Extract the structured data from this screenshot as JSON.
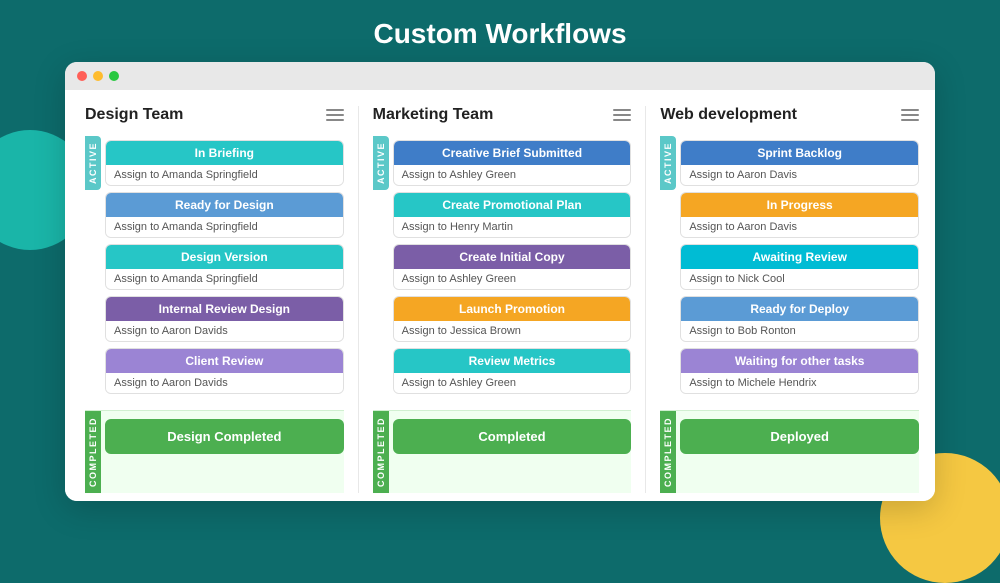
{
  "page": {
    "title": "Custom Workflows",
    "background_color": "#0d6b6b"
  },
  "columns": [
    {
      "id": "design-team",
      "title": "Design Team",
      "active_label": "ACTIVE",
      "completed_label": "COMPLETED",
      "tasks": [
        {
          "label": "In Briefing",
          "color_class": "color-teal",
          "assignee": "Assign to Amanda Springfield"
        },
        {
          "label": "Ready for Design",
          "color_class": "color-blue-light",
          "assignee": "Assign to Amanda Springfield"
        },
        {
          "label": "Design Version",
          "color_class": "color-teal",
          "assignee": "Assign to Amanda Springfield"
        },
        {
          "label": "Internal Review Design",
          "color_class": "color-purple",
          "assignee": "Assign to Aaron Davids"
        },
        {
          "label": "Client Review",
          "color_class": "color-lavender",
          "assignee": "Assign to Aaron Davids"
        }
      ],
      "completed_task": "Design Completed"
    },
    {
      "id": "marketing-team",
      "title": "Marketing Team",
      "active_label": "ACTIVE",
      "completed_label": "COMPLETED",
      "tasks": [
        {
          "label": "Creative Brief Submitted",
          "color_class": "color-blue",
          "assignee": "Assign to Ashley Green"
        },
        {
          "label": "Create Promotional Plan",
          "color_class": "color-teal",
          "assignee": "Assign to Henry Martin"
        },
        {
          "label": "Create Initial Copy",
          "color_class": "color-purple",
          "assignee": "Assign to Ashley Green"
        },
        {
          "label": "Launch Promotion",
          "color_class": "color-orange",
          "assignee": "Assign to Jessica Brown"
        },
        {
          "label": "Review Metrics",
          "color_class": "color-teal",
          "assignee": "Assign to Ashley Green"
        }
      ],
      "completed_task": "Completed"
    },
    {
      "id": "web-development",
      "title": "Web development",
      "active_label": "ACTIVE",
      "completed_label": "COMPLETED",
      "tasks": [
        {
          "label": "Sprint Backlog",
          "color_class": "color-blue",
          "assignee": "Assign to Aaron Davis"
        },
        {
          "label": "In Progress",
          "color_class": "color-orange",
          "assignee": "Assign to Aaron Davis"
        },
        {
          "label": "Awaiting Review",
          "color_class": "color-cyan",
          "assignee": "Assign to Nick Cool"
        },
        {
          "label": "Ready for Deploy",
          "color_class": "color-blue-light",
          "assignee": "Assign to Bob Ronton"
        },
        {
          "label": "Waiting for other tasks",
          "color_class": "color-lavender",
          "assignee": "Assign to Michele Hendrix"
        }
      ],
      "completed_task": "Deployed"
    }
  ]
}
